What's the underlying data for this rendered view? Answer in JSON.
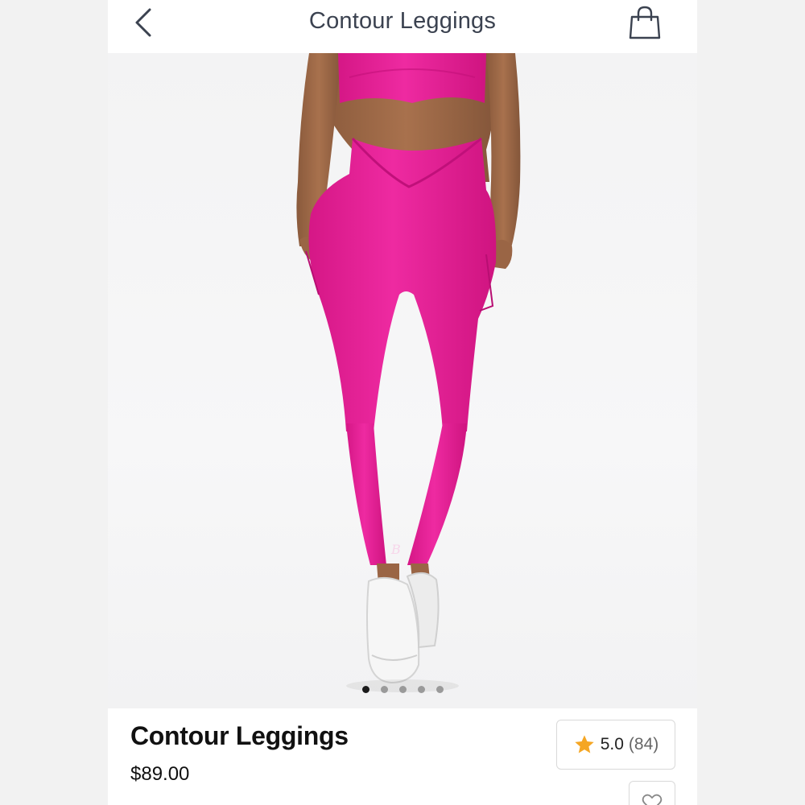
{
  "header": {
    "title": "Contour Leggings",
    "back_icon": "chevron-left-icon",
    "bag_icon": "shopping-bag-icon"
  },
  "gallery": {
    "image_alt": "Model wearing hot pink contour leggings with matching crop top and white sneakers",
    "dots_count": 5,
    "active_index": 0
  },
  "product": {
    "name": "Contour Leggings",
    "price": "$89.00",
    "rating_value": "5.0",
    "rating_count": "(84)",
    "star_icon": "star-icon",
    "favorite_icon": "heart-icon"
  },
  "colors": {
    "leggings": "#e8239a",
    "star": "#f5a623",
    "title_text": "#3b4250"
  }
}
